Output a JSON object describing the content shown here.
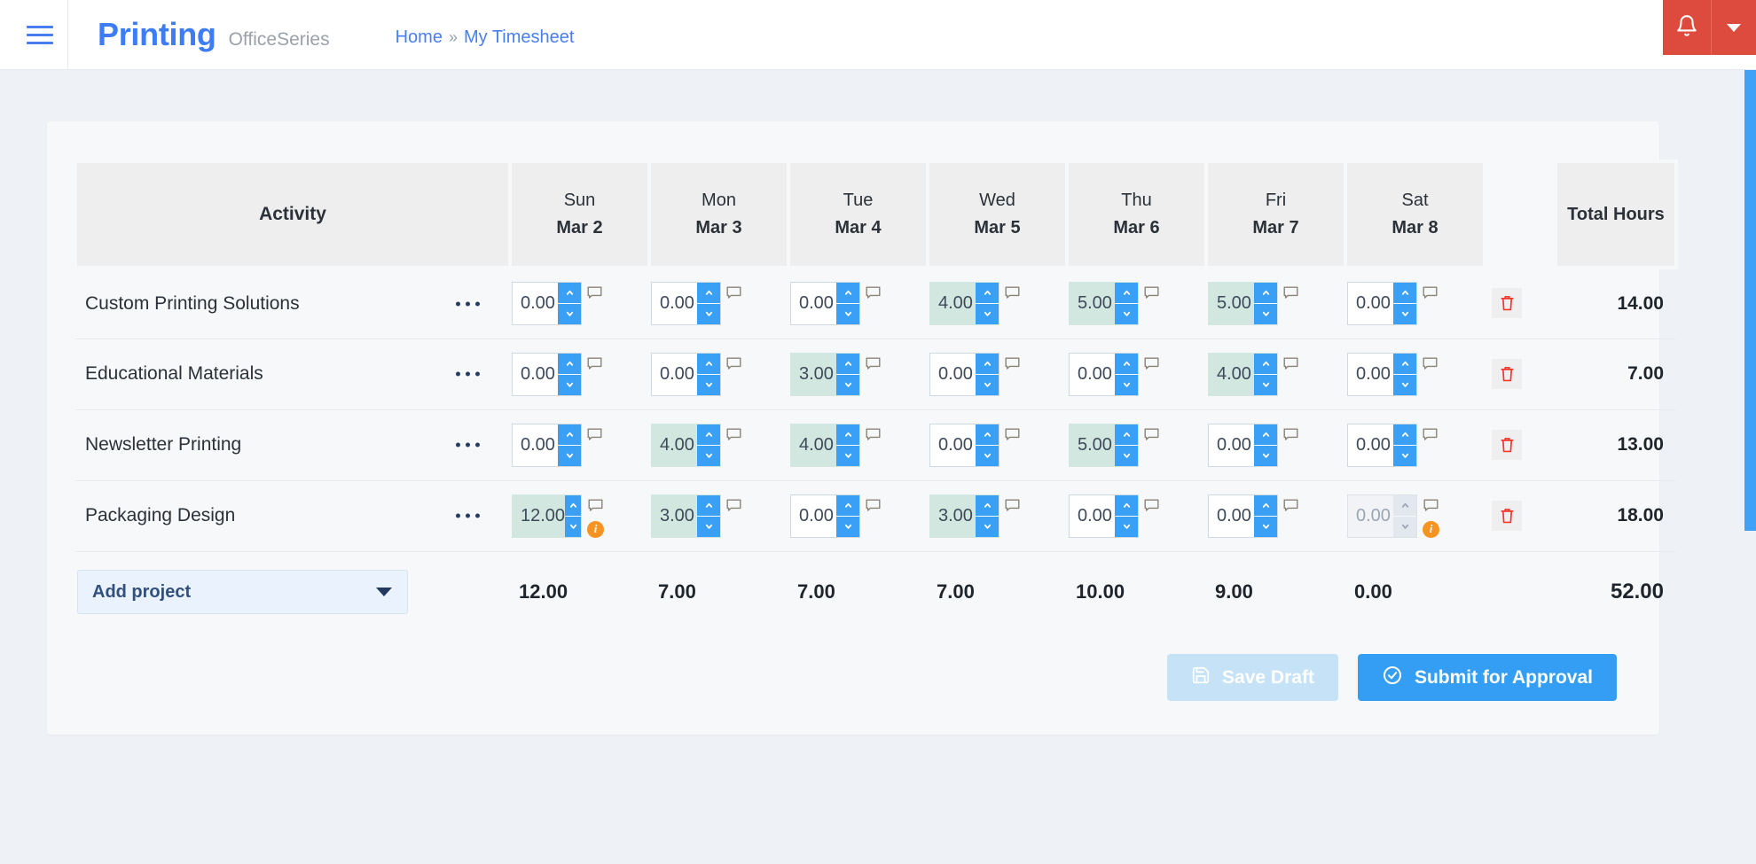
{
  "navbar": {
    "menu_icon": "hamburger-icon",
    "brand_name": "Printing",
    "brand_sub": "OfficeSeries",
    "breadcrumb": {
      "home": "Home",
      "separator": "»",
      "current": "My Timesheet"
    },
    "notification_icon": "bell-icon",
    "notification_caret_icon": "chevron-down-icon",
    "accent_red": "#dd4b3e",
    "accent_blue": "#3d7cf4"
  },
  "table": {
    "headers": {
      "activity": "Activity",
      "total": "Total Hours",
      "days": [
        {
          "dayname": "Sun",
          "daydate": "Mar 2"
        },
        {
          "dayname": "Mon",
          "daydate": "Mar 3"
        },
        {
          "dayname": "Tue",
          "daydate": "Mar 4"
        },
        {
          "dayname": "Wed",
          "daydate": "Mar 5"
        },
        {
          "dayname": "Thu",
          "daydate": "Mar 6"
        },
        {
          "dayname": "Fri",
          "daydate": "Mar 7"
        },
        {
          "dayname": "Sat",
          "daydate": "Mar 8"
        }
      ]
    },
    "rows": [
      {
        "activity": "Custom Printing Solutions",
        "menu_label": "···",
        "total": "14.00",
        "cells": [
          {
            "value": "0.00",
            "filled": false,
            "disabled": false,
            "info": false
          },
          {
            "value": "0.00",
            "filled": false,
            "disabled": false,
            "info": false
          },
          {
            "value": "0.00",
            "filled": false,
            "disabled": false,
            "info": false
          },
          {
            "value": "4.00",
            "filled": true,
            "disabled": false,
            "info": false
          },
          {
            "value": "5.00",
            "filled": true,
            "disabled": false,
            "info": false
          },
          {
            "value": "5.00",
            "filled": true,
            "disabled": false,
            "info": false
          },
          {
            "value": "0.00",
            "filled": false,
            "disabled": false,
            "info": false
          }
        ]
      },
      {
        "activity": "Educational Materials",
        "menu_label": "···",
        "total": "7.00",
        "cells": [
          {
            "value": "0.00",
            "filled": false,
            "disabled": false,
            "info": false
          },
          {
            "value": "0.00",
            "filled": false,
            "disabled": false,
            "info": false
          },
          {
            "value": "3.00",
            "filled": true,
            "disabled": false,
            "info": false
          },
          {
            "value": "0.00",
            "filled": false,
            "disabled": false,
            "info": false
          },
          {
            "value": "0.00",
            "filled": false,
            "disabled": false,
            "info": false
          },
          {
            "value": "4.00",
            "filled": true,
            "disabled": false,
            "info": false
          },
          {
            "value": "0.00",
            "filled": false,
            "disabled": false,
            "info": false
          }
        ]
      },
      {
        "activity": "Newsletter Printing",
        "menu_label": "···",
        "total": "13.00",
        "cells": [
          {
            "value": "0.00",
            "filled": false,
            "disabled": false,
            "info": false
          },
          {
            "value": "4.00",
            "filled": true,
            "disabled": false,
            "info": false
          },
          {
            "value": "4.00",
            "filled": true,
            "disabled": false,
            "info": false
          },
          {
            "value": "0.00",
            "filled": false,
            "disabled": false,
            "info": false
          },
          {
            "value": "5.00",
            "filled": true,
            "disabled": false,
            "info": false
          },
          {
            "value": "0.00",
            "filled": false,
            "disabled": false,
            "info": false
          },
          {
            "value": "0.00",
            "filled": false,
            "disabled": false,
            "info": false
          }
        ]
      },
      {
        "activity": "Packaging Design",
        "menu_label": "···",
        "total": "18.00",
        "cells": [
          {
            "value": "12.00",
            "filled": true,
            "disabled": false,
            "info": true
          },
          {
            "value": "3.00",
            "filled": true,
            "disabled": false,
            "info": false
          },
          {
            "value": "0.00",
            "filled": false,
            "disabled": false,
            "info": false
          },
          {
            "value": "3.00",
            "filled": true,
            "disabled": false,
            "info": false
          },
          {
            "value": "0.00",
            "filled": false,
            "disabled": false,
            "info": false
          },
          {
            "value": "0.00",
            "filled": false,
            "disabled": false,
            "info": false
          },
          {
            "value": "0.00",
            "filled": false,
            "disabled": true,
            "info": true
          }
        ]
      }
    ],
    "footer": {
      "add_project_label": "Add project",
      "column_totals": [
        "12.00",
        "7.00",
        "7.00",
        "7.00",
        "10.00",
        "9.00",
        "0.00"
      ],
      "grand_total": "52.00"
    }
  },
  "actions": {
    "save_label": "Save Draft",
    "save_icon": "floppy-disk-icon",
    "save_disabled": true,
    "submit_label": "Submit for Approval",
    "submit_icon": "check-circle-icon",
    "submit_color": "#339ef4"
  }
}
